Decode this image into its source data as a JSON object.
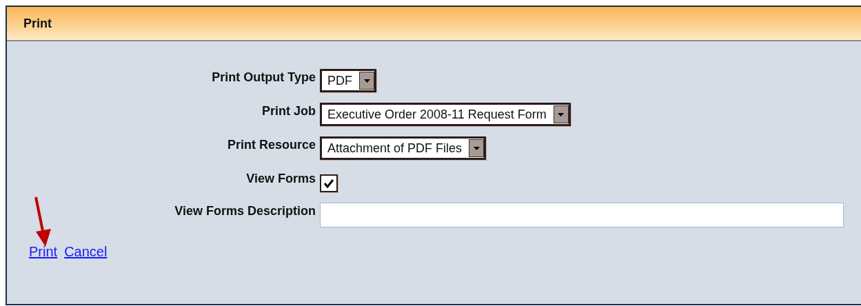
{
  "panel": {
    "title": "Print"
  },
  "fields": [
    {
      "kind": "select",
      "label": "Print Output Type",
      "value": "PDF"
    },
    {
      "kind": "select",
      "label": "Print Job",
      "value": "Executive Order 2008-11 Request Form"
    },
    {
      "kind": "select",
      "label": "Print Resource",
      "value": "Attachment of PDF Files"
    },
    {
      "kind": "checkbox",
      "label": "View Forms",
      "checked": true
    },
    {
      "kind": "text",
      "label": "View Forms Description"
    }
  ],
  "links": [
    "Print",
    "Cancel"
  ]
}
